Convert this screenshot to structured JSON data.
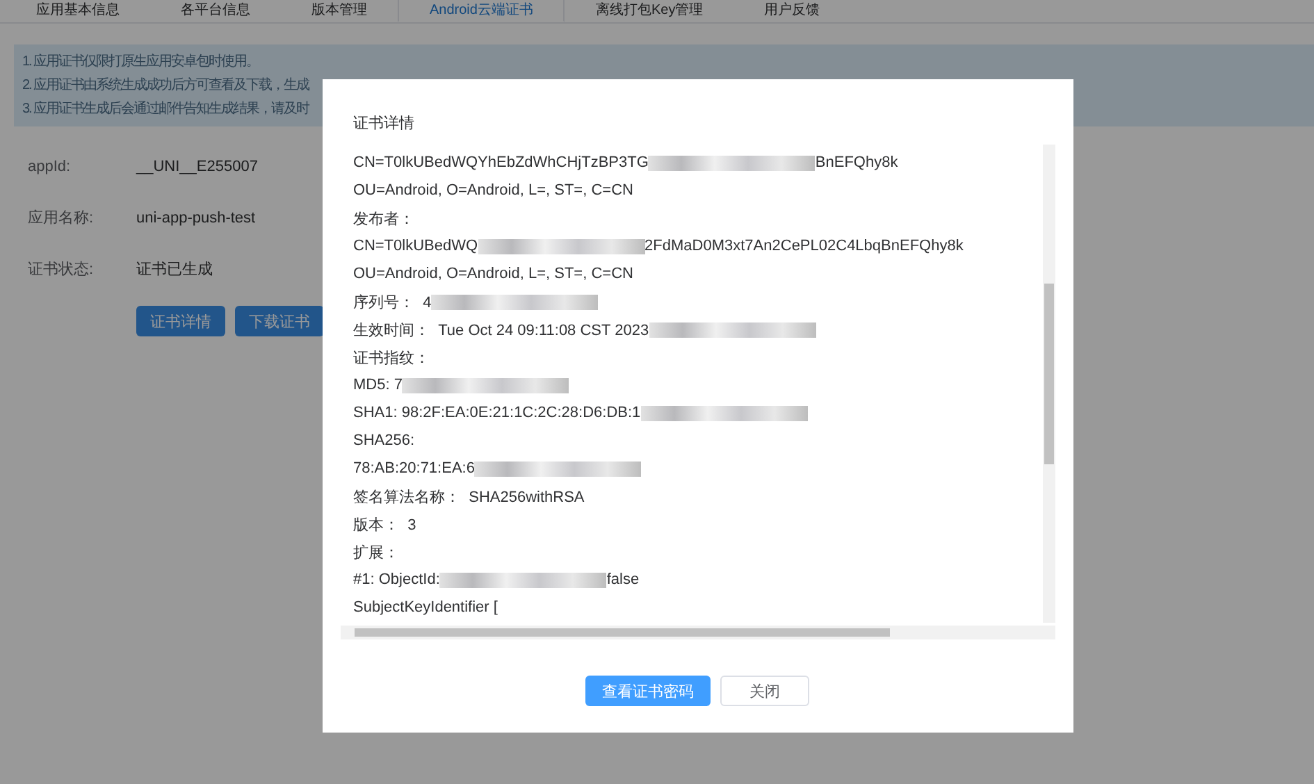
{
  "tabs": [
    {
      "label": "应用基本信息",
      "selected": false
    },
    {
      "label": "各平台信息",
      "selected": false
    },
    {
      "label": "版本管理",
      "selected": false
    },
    {
      "label": "Android云端证书",
      "selected": true
    },
    {
      "label": "离线打包Key管理",
      "selected": false
    },
    {
      "label": "用户反馈",
      "selected": false
    }
  ],
  "notice": [
    "1. 应用证书仅限打原生应用安卓包时使用。",
    "2. 应用证书由系统生成成功后方可查看及下载，生成",
    "3. 应用证书生成后会通过邮件告知生成结果，请及时"
  ],
  "fields": [
    {
      "label": "appId:",
      "value": "__UNI__E255007"
    },
    {
      "label": "应用名称:",
      "value": "uni-app-push-test"
    },
    {
      "label": "证书状态:",
      "value": "证书已生成"
    }
  ],
  "actions": [
    "证书详情",
    "下载证书"
  ],
  "dialog": {
    "title": "证书详情",
    "lines": [
      [
        {
          "kind": "text",
          "text": "CN=T0lkUBedWQYhEbZdWhCHjTzBP3TG"
        },
        {
          "kind": "blur"
        },
        {
          "kind": "text",
          "text": "BnEFQhy8k"
        }
      ],
      [
        {
          "kind": "text",
          "text": "OU=Android, O=Android, L=, ST=, C=CN"
        }
      ],
      [
        {
          "kind": "text",
          "text": "发布者："
        }
      ],
      [
        {
          "kind": "text",
          "text": "CN=T0lkUBedWQ"
        },
        {
          "kind": "blur"
        },
        {
          "kind": "text",
          "text": "2FdMaD0M3xt7An2CePL02C4LbqBnEFQhy8k"
        }
      ],
      [
        {
          "kind": "text",
          "text": "OU=Android, O=Android, L=, ST=, C=CN"
        }
      ],
      [
        {
          "kind": "text",
          "text": "序列号：  4"
        },
        {
          "kind": "blur"
        }
      ],
      [
        {
          "kind": "text",
          "text": "生效时间：  Tue Oct 24 09:11:08 CST 2023"
        },
        {
          "kind": "blur"
        }
      ],
      [
        {
          "kind": "text",
          "text": "证书指纹："
        }
      ],
      [
        {
          "kind": "text",
          "text": "MD5: 7"
        },
        {
          "kind": "blur"
        }
      ],
      [
        {
          "kind": "text",
          "text": "SHA1: 98:2F:EA:0E:21:1C:2C:28:D6:DB:1"
        },
        {
          "kind": "blur"
        }
      ],
      [
        {
          "kind": "text",
          "text": "SHA256:"
        }
      ],
      [
        {
          "kind": "text",
          "text": "78:AB:20:71:EA:6"
        },
        {
          "kind": "blur"
        }
      ],
      [
        {
          "kind": "text",
          "text": "签名算法名称：  SHA256withRSA"
        }
      ],
      [
        {
          "kind": "text",
          "text": "版本：  3"
        }
      ],
      [
        {
          "kind": "text",
          "text": "扩展："
        }
      ],
      [
        {
          "kind": "text",
          "text": "#1: ObjectId:"
        },
        {
          "kind": "blur"
        },
        {
          "kind": "text",
          "text": "false"
        }
      ],
      [
        {
          "kind": "text",
          "text": "SubjectKeyIdentifier ["
        }
      ]
    ],
    "buttons": [
      {
        "label": "查看证书密码",
        "kind": "primary"
      },
      {
        "label": "关闭",
        "kind": "plain"
      }
    ]
  }
}
